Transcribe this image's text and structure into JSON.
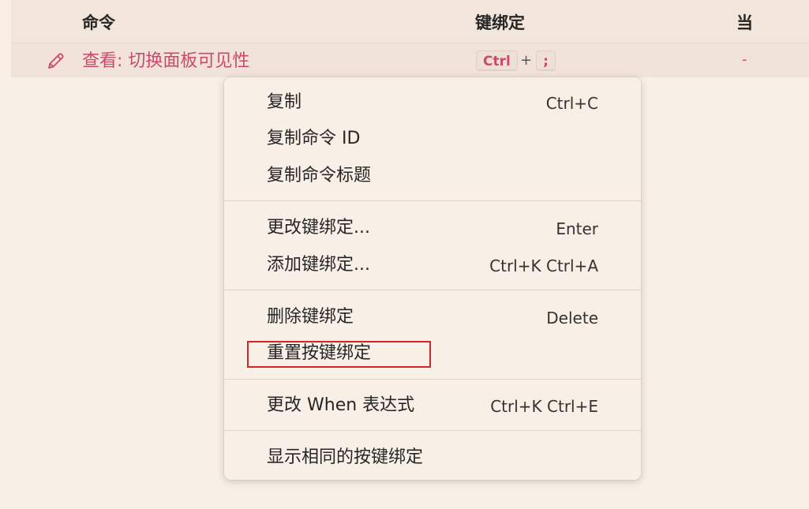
{
  "table": {
    "headers": {
      "command": "命令",
      "keybinding": "键绑定",
      "when": "当"
    },
    "row": {
      "icon": "pencil-edit-icon",
      "command": "查看: 切换面板可见性",
      "keys": [
        "Ctrl",
        ";"
      ],
      "key_joiner": "+",
      "when": "-"
    }
  },
  "context_menu": {
    "groups": [
      [
        {
          "label": "复制",
          "shortcut": "Ctrl+C"
        },
        {
          "label": "复制命令 ID",
          "shortcut": ""
        },
        {
          "label": "复制命令标题",
          "shortcut": ""
        }
      ],
      [
        {
          "label": "更改键绑定...",
          "shortcut": "Enter"
        },
        {
          "label": "添加键绑定...",
          "shortcut": "Ctrl+K Ctrl+A"
        }
      ],
      [
        {
          "label": "删除键绑定",
          "shortcut": "Delete"
        },
        {
          "label": "重置按键绑定",
          "shortcut": "",
          "highlighted": true
        }
      ],
      [
        {
          "label": "更改 When 表达式",
          "shortcut": "Ctrl+K Ctrl+E"
        }
      ],
      [
        {
          "label": "显示相同的按键绑定",
          "shortcut": ""
        }
      ]
    ]
  },
  "colors": {
    "background": "#f8efe6",
    "accent": "#c94a6c",
    "highlight_border": "#d8222a"
  }
}
